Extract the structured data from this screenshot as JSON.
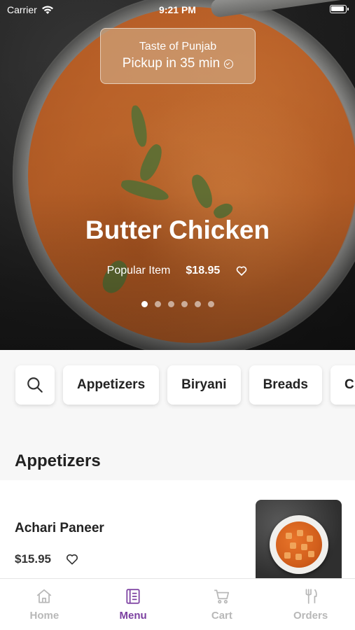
{
  "status_bar": {
    "carrier": "Carrier",
    "time": "9:21 PM"
  },
  "restaurant": {
    "name": "Taste of Punjab",
    "pickup": "Pickup in 35 min"
  },
  "featured": {
    "title": "Butter Chicken",
    "tag": "Popular Item",
    "price": "$18.95",
    "carousel_total": 6,
    "carousel_active": 1
  },
  "categories": [
    "Appetizers",
    "Biryani",
    "Breads",
    "C"
  ],
  "section": {
    "title": "Appetizers"
  },
  "items": [
    {
      "name": "Achari Paneer",
      "price": "$15.95"
    }
  ],
  "tabbar": {
    "home": "Home",
    "menu": "Menu",
    "cart": "Cart",
    "orders": "Orders",
    "active": "menu"
  },
  "colors": {
    "accent": "#7b3fa0",
    "inactive_tab": "#b8b8b8"
  }
}
